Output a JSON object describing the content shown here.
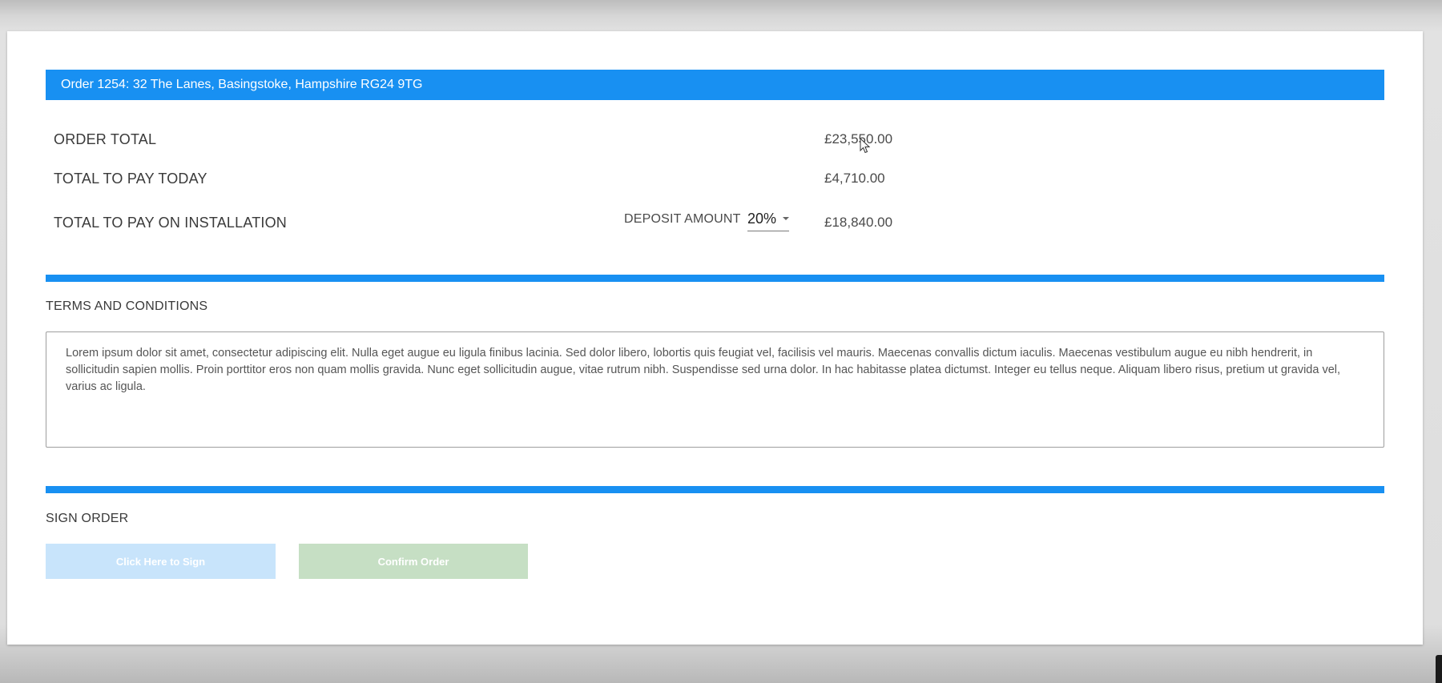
{
  "order": {
    "header": "Order 1254: 32 The Lanes, Basingstoke, Hampshire RG24 9TG"
  },
  "summary": {
    "order_total_label": "ORDER TOTAL",
    "order_total_value": "£23,550.00",
    "pay_today_label": "TOTAL TO PAY TODAY",
    "pay_today_value": "£4,710.00",
    "pay_installation_label": "TOTAL TO PAY ON INSTALLATION",
    "pay_installation_value": "£18,840.00",
    "deposit_label": "DEPOSIT AMOUNT",
    "deposit_selected": "20%"
  },
  "terms": {
    "title": "TERMS AND CONDITIONS",
    "text": "Lorem ipsum dolor sit amet, consectetur adipiscing elit. Nulla eget augue eu ligula finibus lacinia. Sed dolor libero, lobortis quis feugiat vel, facilisis vel mauris. Maecenas convallis dictum iaculis. Maecenas vestibulum augue eu nibh hendrerit, in sollicitudin sapien mollis. Proin porttitor eros non quam mollis gravida. Nunc eget sollicitudin augue, vitae rutrum nibh. Suspendisse sed urna dolor. In hac habitasse platea dictumst. Integer eu tellus neque. Aliquam libero risus, pretium ut gravida vel, varius ac ligula."
  },
  "sign": {
    "title": "SIGN ORDER",
    "sign_button": "Click Here to Sign",
    "confirm_button": "Confirm Order"
  },
  "colors": {
    "accent": "#1890f2",
    "sign_button_bg": "#c8e4fb",
    "confirm_button_bg": "#c6dfc4"
  },
  "icons": {
    "cursor": "mouse-cursor-icon",
    "dropdown": "caret-down-icon"
  }
}
